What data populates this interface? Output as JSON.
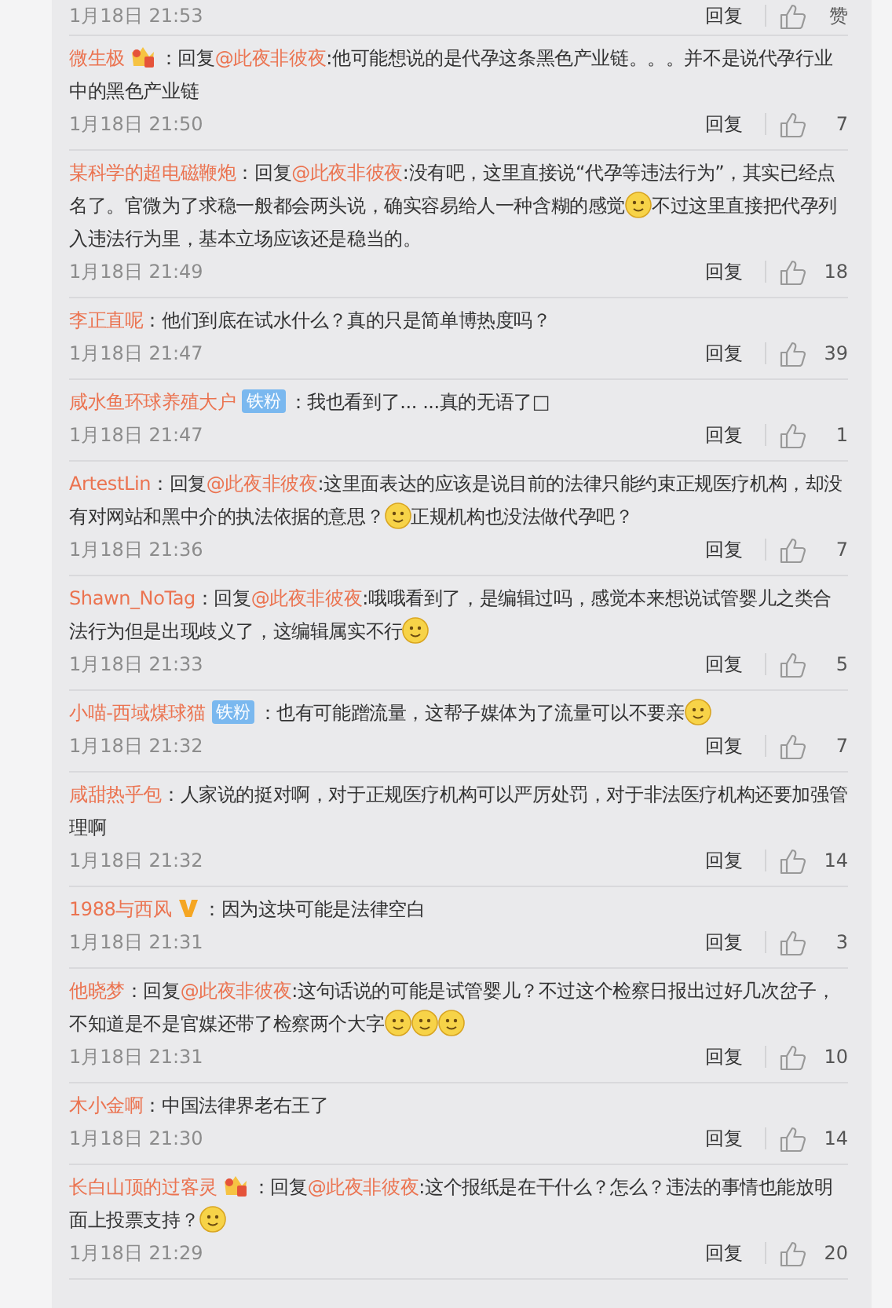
{
  "comments": [
    {
      "kind": "cut",
      "time": "1月18日 21:53",
      "reply_label": "回复",
      "likes": "赞"
    },
    {
      "kind": "comment",
      "author": "微生极",
      "badge": {
        "kind": "crown"
      },
      "body": [
        {
          "kind": "text",
          "text": "：回复"
        },
        {
          "kind": "mention",
          "text": "@此夜非彼夜"
        },
        {
          "kind": "text",
          "text": ":他可能想说的是代孕这条黑色产业链。。。并不是说代孕行业中的黑色产业链"
        }
      ],
      "time": "1月18日 21:50",
      "reply_label": "回复",
      "likes": "7"
    },
    {
      "kind": "comment",
      "author": "某科学的超电磁鞭炮",
      "body": [
        {
          "kind": "text",
          "text": "：回复"
        },
        {
          "kind": "mention",
          "text": "@此夜非彼夜"
        },
        {
          "kind": "text",
          "text": ":没有吧，这里直接说“代孕等违法行为”，其实已经点名了。官微为了求稳一般都会两头说，确实容易给人一种含糊的感觉"
        },
        {
          "kind": "emoji"
        },
        {
          "kind": "text",
          "text": "不过这里直接把代孕列入违法行为里，基本立场应该还是稳当的。"
        }
      ],
      "time": "1月18日 21:49",
      "reply_label": "回复",
      "likes": "18"
    },
    {
      "kind": "comment",
      "author": "李正直呢",
      "body": [
        {
          "kind": "text",
          "text": "：他们到底在试水什么？真的只是简单博热度吗？"
        }
      ],
      "time": "1月18日 21:47",
      "reply_label": "回复",
      "likes": "39"
    },
    {
      "kind": "comment",
      "author": "咸水鱼环球养殖大户",
      "badge": {
        "kind": "fan",
        "label": "铁粉"
      },
      "body": [
        {
          "kind": "text",
          "text": "：我也看到了... ...真的无语了□"
        }
      ],
      "time": "1月18日 21:47",
      "reply_label": "回复",
      "likes": "1"
    },
    {
      "kind": "comment",
      "author": "ArtestLin",
      "body": [
        {
          "kind": "text",
          "text": "：回复"
        },
        {
          "kind": "mention",
          "text": "@此夜非彼夜"
        },
        {
          "kind": "text",
          "text": ":这里面表达的应该是说目前的法律只能约束正规医疗机构，却没有对网站和黑中介的执法依据的意思？"
        },
        {
          "kind": "emoji"
        },
        {
          "kind": "text",
          "text": "正规机构也没法做代孕吧？"
        }
      ],
      "time": "1月18日 21:36",
      "reply_label": "回复",
      "likes": "7"
    },
    {
      "kind": "comment",
      "author": "Shawn_NoTag",
      "body": [
        {
          "kind": "text",
          "text": "：回复"
        },
        {
          "kind": "mention",
          "text": "@此夜非彼夜"
        },
        {
          "kind": "text",
          "text": ":哦哦看到了，是编辑过吗，感觉本来想说试管婴儿之类合法行为但是出现歧义了，这编辑属实不行"
        },
        {
          "kind": "emoji"
        }
      ],
      "time": "1月18日 21:33",
      "reply_label": "回复",
      "likes": "5"
    },
    {
      "kind": "comment",
      "author": "小喵-西域煤球猫",
      "badge": {
        "kind": "fan",
        "label": "铁粉"
      },
      "body": [
        {
          "kind": "text",
          "text": "：也有可能蹭流量，这帮子媒体为了流量可以不要亲"
        },
        {
          "kind": "emoji"
        }
      ],
      "time": "1月18日 21:32",
      "reply_label": "回复",
      "likes": "7"
    },
    {
      "kind": "comment",
      "author": "咸甜热乎包",
      "body": [
        {
          "kind": "text",
          "text": "：人家说的挺对啊，对于正规医疗机构可以严厉处罚，对于非法医疗机构还要加强管理啊"
        }
      ],
      "time": "1月18日 21:32",
      "reply_label": "回复",
      "likes": "14"
    },
    {
      "kind": "comment",
      "author": "1988与西风",
      "badge": {
        "kind": "verified"
      },
      "body": [
        {
          "kind": "text",
          "text": "：因为这块可能是法律空白"
        }
      ],
      "time": "1月18日 21:31",
      "reply_label": "回复",
      "likes": "3"
    },
    {
      "kind": "comment",
      "author": "他晓梦",
      "body": [
        {
          "kind": "text",
          "text": "：回复"
        },
        {
          "kind": "mention",
          "text": "@此夜非彼夜"
        },
        {
          "kind": "text",
          "text": ":这句话说的可能是试管婴儿？不过这个检察日报出过好几次岔子，不知道是不是官媒还带了检察两个大字"
        },
        {
          "kind": "emoji"
        },
        {
          "kind": "emoji"
        },
        {
          "kind": "emoji"
        }
      ],
      "time": "1月18日 21:31",
      "reply_label": "回复",
      "likes": "10"
    },
    {
      "kind": "comment",
      "author": "木小金啊",
      "body": [
        {
          "kind": "text",
          "text": "：中国法律界老右王了"
        }
      ],
      "time": "1月18日 21:30",
      "reply_label": "回复",
      "likes": "14"
    },
    {
      "kind": "comment",
      "author": "长白山顶的过客灵",
      "badge": {
        "kind": "crown"
      },
      "body": [
        {
          "kind": "text",
          "text": "：回复"
        },
        {
          "kind": "mention",
          "text": "@此夜非彼夜"
        },
        {
          "kind": "text",
          "text": ":这个报纸是在干什么？怎么？违法的事情也能放明面上投票支持？"
        },
        {
          "kind": "emoji"
        }
      ],
      "time": "1月18日 21:29",
      "reply_label": "回复",
      "likes": "20"
    }
  ]
}
